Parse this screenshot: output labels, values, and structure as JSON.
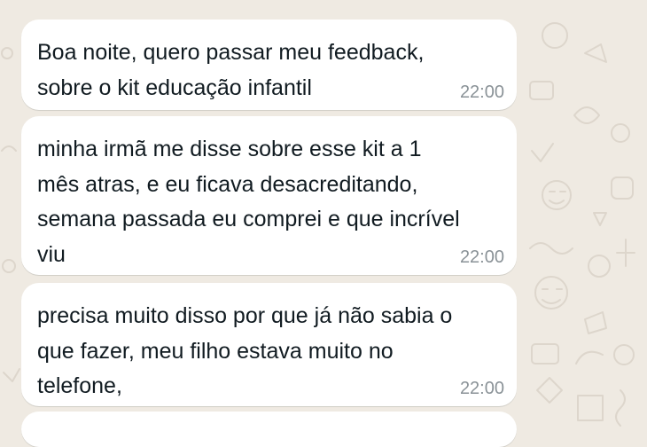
{
  "chat": {
    "wallpaper_color": "#efeae2",
    "bubble_color": "#ffffff",
    "messages": [
      {
        "text": "Boa noite, quero passar meu feedback, sobre o kit educação infantil",
        "time": "22:00"
      },
      {
        "text": "minha irmã me disse sobre esse kit a 1 mês atras, e eu ficava desacreditando, semana passada eu comprei e que incrível viu",
        "time": "22:00"
      },
      {
        "text": "precisa muito disso por que já não sabia o que fazer, meu filho estava muito no telefone,",
        "time": "22:00"
      }
    ]
  }
}
